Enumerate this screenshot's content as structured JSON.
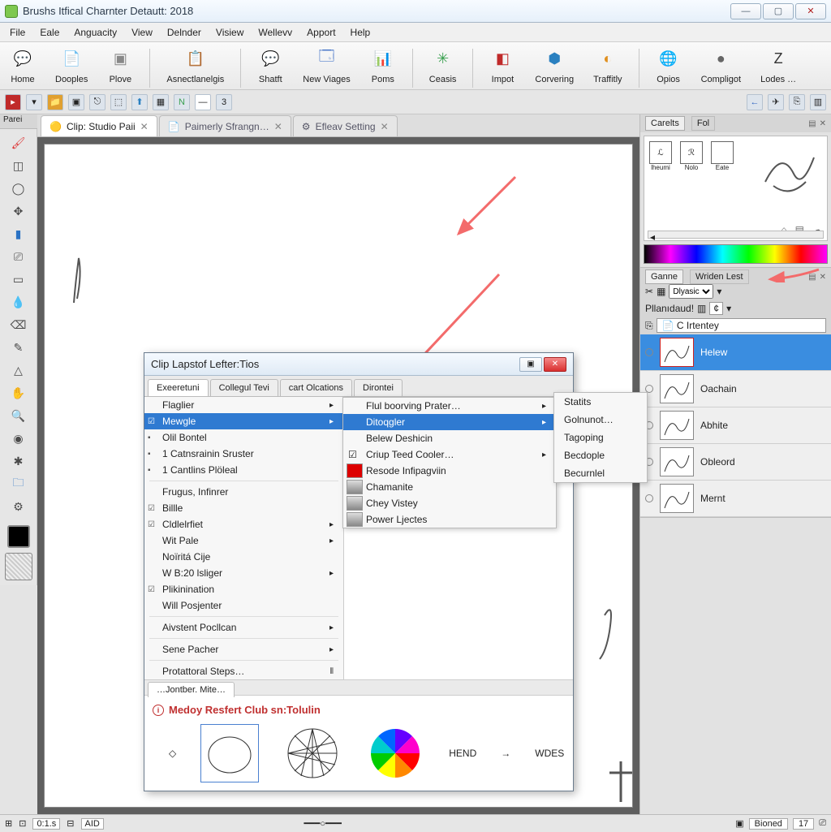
{
  "window": {
    "title": "Brushs Itfical Charnter Detautt: 2018",
    "buttons": {
      "min": "—",
      "max": "▢",
      "close": "✕"
    }
  },
  "menubar": [
    "File",
    "Eale",
    "Anguacity",
    "View",
    "Delnder",
    "Visiew",
    "Wellevv",
    "Apport",
    "Help"
  ],
  "ribbon": [
    {
      "label": "Home",
      "icon": "💬",
      "color": "#6dbb3a"
    },
    {
      "label": "Dooples",
      "icon": "📄",
      "color": "#888"
    },
    {
      "label": "Plove",
      "icon": "▣",
      "color": "#888"
    },
    {
      "label": "Asnectlanelgis",
      "icon": "📋",
      "color": "#c78f3a"
    },
    {
      "label": "Shatft",
      "icon": "💬",
      "color": "#e0a030"
    },
    {
      "label": "New Viages",
      "icon": "🗔",
      "color": "#2a60c0"
    },
    {
      "label": "Poms",
      "icon": "📊",
      "color": "#c74a2a"
    },
    {
      "label": "Ceasis",
      "icon": "✳",
      "color": "#3aa050"
    },
    {
      "label": "Impot",
      "icon": "◧",
      "color": "#c02a2a"
    },
    {
      "label": "Corvering",
      "icon": "⬢",
      "color": "#2a80c0"
    },
    {
      "label": "Traffitly",
      "icon": "◐",
      "color": "#e09020"
    },
    {
      "label": "Opios",
      "icon": "🌐",
      "color": "#2a80c0"
    },
    {
      "label": "Compligot",
      "icon": "●",
      "color": "#666"
    },
    {
      "label": "Lodes …",
      "icon": "Z",
      "color": "#333"
    }
  ],
  "doctabs": [
    {
      "label": "Clip: Studio Paii ",
      "active": true,
      "icon": "🟡"
    },
    {
      "label": "Paimerly Sfrangn…",
      "active": false,
      "icon": "📄"
    },
    {
      "label": "Efleav Setting",
      "active": false,
      "icon": "⚙"
    }
  ],
  "dialog": {
    "title": "Clip Lapstof Lefter:Tios",
    "tabs": [
      "Exeeretuni",
      "Collegul Tevi",
      "cart Olcations",
      "Dirontei"
    ],
    "active_tab": 0,
    "menu": [
      {
        "label": "Flaglier",
        "arrow": true
      },
      {
        "label": "Mewgle",
        "arrow": true,
        "highlight": true,
        "check": true
      },
      {
        "label": "Olil Bontel",
        "icon": true
      },
      {
        "label": "1 Catnsrainin Sruster",
        "icon": true
      },
      {
        "label": "1 Cantlins Plöleal",
        "icon": true
      },
      {
        "sep": true
      },
      {
        "label": "Frugus, Infinrer"
      },
      {
        "label": "Billle",
        "check": true
      },
      {
        "label": "Cldlelrfiet",
        "check": true,
        "arrow": true
      },
      {
        "label": "Wit Pale",
        "arrow": true
      },
      {
        "label": "Noïritá Cije"
      },
      {
        "label": "W B:20 lsliger",
        "arrow": true
      },
      {
        "label": "Plikinination",
        "check": true
      },
      {
        "label": "Will Posjenter"
      },
      {
        "sep": true
      },
      {
        "label": "Aivstent Pocllcan",
        "arrow": true
      },
      {
        "sep": true
      },
      {
        "label": "Sene Pacher",
        "arrow": true
      },
      {
        "sep": true
      },
      {
        "label": "Protattoral Steps…",
        "note": "⦀"
      }
    ],
    "submenu": [
      {
        "label": "Flul boorving Prater…",
        "arrow": true
      },
      {
        "label": "Ditoqgler",
        "highlight": true,
        "arrow": true
      },
      {
        "label": "Belew Deshicin"
      },
      {
        "label": "Criup Teed Cooler…",
        "check": true,
        "arrow": true
      },
      {
        "label": "Resode Infipagviin",
        "ico": "red"
      },
      {
        "label": "Chamanite",
        "ico": "oval"
      },
      {
        "label": "Chey Vistey",
        "ico": "tex"
      },
      {
        "label": "Power Ljectes",
        "ico": "tex2"
      }
    ],
    "flyout": [
      "Statits",
      "Golnunot…",
      "Tagoping",
      "Becdople",
      "Becurnlel"
    ],
    "bottom": {
      "tab": "…Jontber. Mite…",
      "title": "Medoy Resfert Club sn:Tolulin",
      "labels": {
        "hend": "HEND",
        "wdes": "WDES"
      }
    }
  },
  "right": {
    "tabs1": {
      "a": "Carelts",
      "b": "Fol"
    },
    "preview": {
      "a": "lheumi",
      "b": "Nolo",
      "c": "Eate"
    },
    "tabs2": {
      "a": "Ganne",
      "b": "Wriden Lest"
    },
    "dropdown1": "Dlyasic",
    "label1": "Pllanıdaud!",
    "filter": "C Irtentey",
    "layers": [
      "Helew",
      "Oachain",
      "Abhite",
      "Obleord",
      "Mernt"
    ]
  },
  "statusbar": {
    "zoom": "0:1.s",
    "mode": "AID",
    "right_tab": "Bioned",
    "right_val": "17"
  }
}
